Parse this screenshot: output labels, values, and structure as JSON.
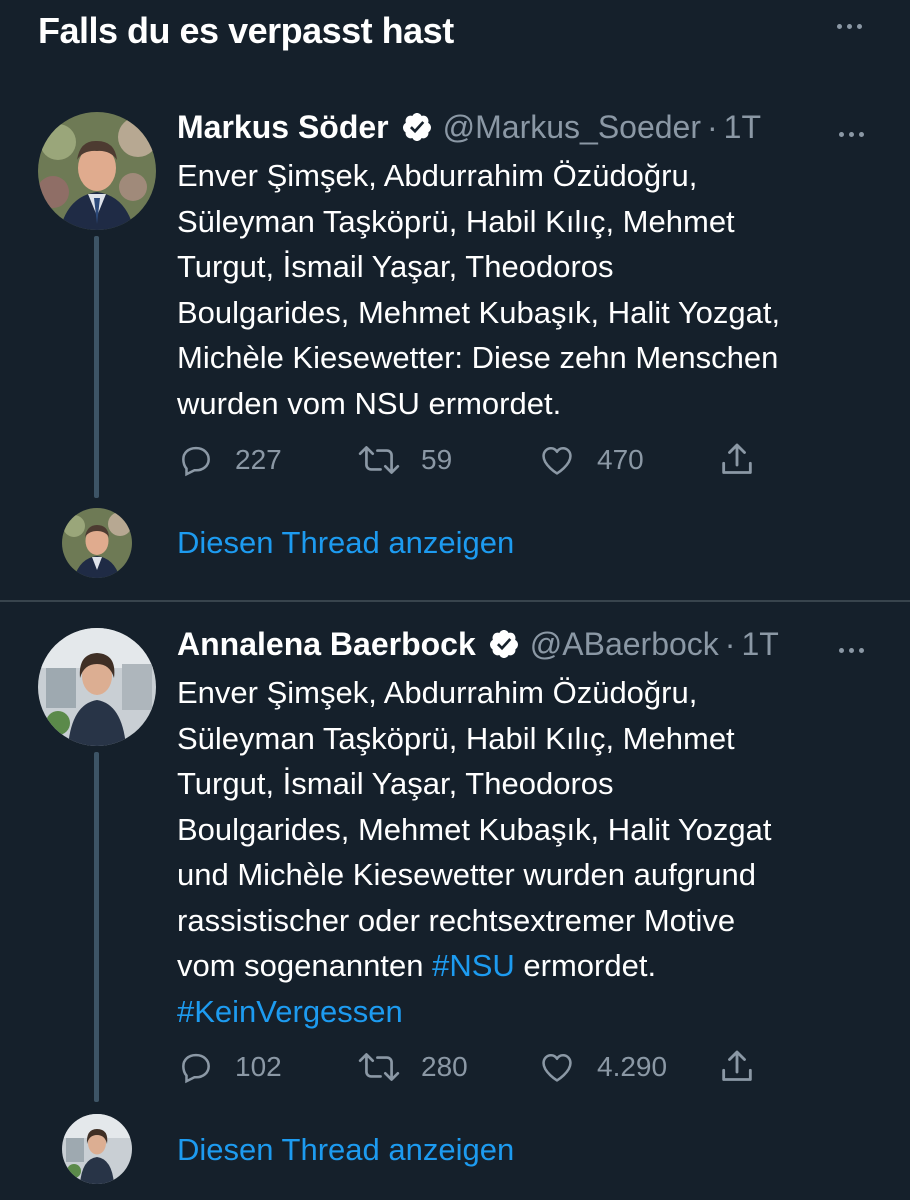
{
  "header": {
    "title": "Falls du es verpasst hast",
    "more_icon": "more-horizontal-icon"
  },
  "colors": {
    "background": "#15202b",
    "text": "#ffffff",
    "muted": "#8b98a5",
    "accent": "#1d9bf0",
    "thread_line": "#3d5466",
    "divider": "#38444d"
  },
  "tweets": [
    {
      "author_name": "Markus Söder",
      "verified": true,
      "handle": "@Markus_Soeder",
      "separator": "·",
      "time": "1T",
      "text_lines": [
        "Enver Şimşek, Abdurrahim Özüdoğru,",
        "Süleyman Taşköprü, Habil Kılıç, Mehmet",
        "Turgut, İsmail Yaşar, Theodoros",
        "Boulgarides, Mehmet Kubaşık, Halit Yozgat,",
        "Michèle Kiesewetter: Diese zehn Menschen",
        "wurden vom NSU ermordet."
      ],
      "replies": "227",
      "retweets": "59",
      "likes": "470",
      "show_thread": "Diesen Thread anzeigen"
    },
    {
      "author_name": "Annalena Baerbock",
      "verified": true,
      "handle": "@ABaerbock",
      "separator": "·",
      "time": "1T",
      "text_lines": [
        "Enver Şimşek, Abdurrahim Özüdoğru,",
        "Süleyman Taşköprü, Habil Kılıç, Mehmet",
        "Turgut, İsmail Yaşar, Theodoros",
        "Boulgarides, Mehmet Kubaşık, Halit Yozgat",
        "und Michèle Kiesewetter wurden aufgrund",
        "rassistischer oder rechtsextremer Motive"
      ],
      "text_line7_pre": "vom sogenannten ",
      "text_line7_tag": "#NSU",
      "text_line7_post": " ermordet.",
      "text_line8_tag": "#KeinVergessen",
      "replies": "102",
      "retweets": "280",
      "likes": "4.290",
      "show_thread": "Diesen Thread anzeigen"
    }
  ]
}
